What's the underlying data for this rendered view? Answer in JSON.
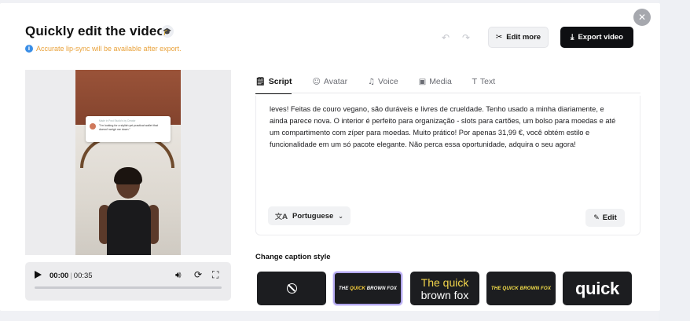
{
  "header": {
    "title": "Quickly edit the video",
    "notice": "Accurate lip-sync will be available after export.",
    "edit_more_label": "Edit more",
    "export_label": "Export video"
  },
  "preview": {
    "overlay_small_head": "Made in Post Studio's by Creator",
    "overlay_text": "\"I'm looking for a stylish yet practical wallet that doesn't weigh me down.\""
  },
  "player": {
    "current_time": "00:00",
    "separator": "|",
    "duration": "00:35",
    "progress": 0.0
  },
  "tabs": [
    {
      "label": "Script",
      "icon": "script-icon",
      "active": true
    },
    {
      "label": "Avatar",
      "icon": "avatar-icon",
      "active": false
    },
    {
      "label": "Voice",
      "icon": "voice-icon",
      "active": false
    },
    {
      "label": "Media",
      "icon": "media-icon",
      "active": false
    },
    {
      "label": "Text",
      "icon": "text-icon",
      "active": false
    }
  ],
  "script": {
    "text": "leves! Feitas de couro vegano, são duráveis e livres de crueldade. Tenho usado a minha diariamente, e ainda parece nova. O interior é perfeito para organização - slots para cartões, um bolso para moedas e até um compartimento com zíper para moedas. Muito prático! Por apenas 31,99 €, você obtém estilo e funcionalidade em um só pacote elegante. Não perca essa oportunidade, adquira o seu agora!",
    "language": "Portuguese",
    "edit_label": "Edit"
  },
  "captions": {
    "label": "Change caption style",
    "styles": [
      {
        "id": "none",
        "text": ""
      },
      {
        "id": "style-1",
        "text": "THE QUICK BROWN FOX",
        "selected": true
      },
      {
        "id": "style-2",
        "line1": "The quick",
        "line2": "brown fox"
      },
      {
        "id": "style-3",
        "text": "THE QUICK BROWN FOX"
      },
      {
        "id": "style-4",
        "text": "quick"
      }
    ]
  },
  "colors": {
    "notice": "#e9a23b",
    "export_bg": "#0e0f12",
    "caption_highlight": "#ffd43b",
    "caption_selected_border": "#b3a8f0"
  }
}
